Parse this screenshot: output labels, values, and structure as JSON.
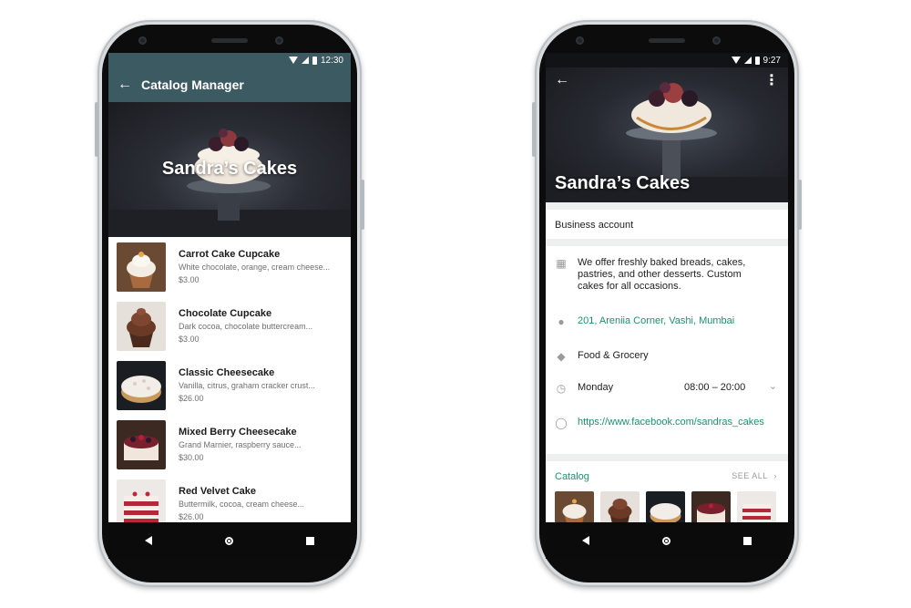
{
  "left_phone": {
    "status_time": "12:30",
    "appbar": {
      "back_icon": "arrow-left",
      "title": "Catalog Manager"
    },
    "hero_title": "Sandra’s Cakes",
    "products": [
      {
        "name": "Carrot Cake Cupcake",
        "desc": "White chocolate, orange, cream cheese...",
        "price": "$3.00",
        "thumb": "cupcake-white"
      },
      {
        "name": "Chocolate Cupcake",
        "desc": "Dark cocoa, chocolate buttercream...",
        "price": "$3.00",
        "thumb": "cupcake-chocolate"
      },
      {
        "name": "Classic Cheesecake",
        "desc": "Vanilla, citrus, graham cracker crust...",
        "price": "$26.00",
        "thumb": "cheesecake"
      },
      {
        "name": "Mixed Berry Cheesecake",
        "desc": "Grand Marnier, raspberry sauce...",
        "price": "$30.00",
        "thumb": "berry-cheesecake"
      },
      {
        "name": "Red Velvet Cake",
        "desc": "Buttermilk, cocoa, cream cheese...",
        "price": "$26.00",
        "thumb": "red-velvet"
      }
    ]
  },
  "right_phone": {
    "status_time": "9:27",
    "business_name": "Sandra’s Cakes",
    "account_type": "Business account",
    "description": "We offer freshly baked breads, cakes, pastries, and other desserts. Custom cakes for all occasions.",
    "address": "201, Areniia Corner, Vashi, Mumbai",
    "category": "Food & Grocery",
    "hours": {
      "day": "Monday",
      "time": "08:00 – 20:00"
    },
    "website": "https://www.facebook.com/sandras_cakes",
    "catalog": {
      "title": "Catalog",
      "see_all": "SEE ALL"
    }
  },
  "colors": {
    "appbar": "#3c5a61",
    "accent_green": "#20906e",
    "nav": "#0b0b0b"
  }
}
